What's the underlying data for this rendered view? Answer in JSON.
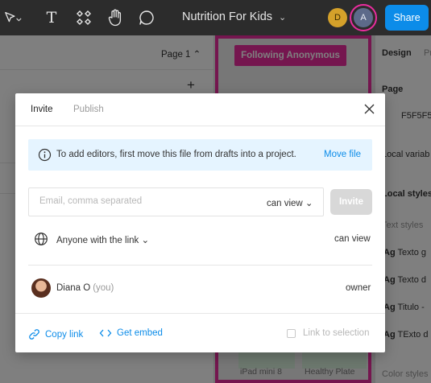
{
  "toolbar": {
    "title": "Nutrition For Kids",
    "title_chevron": "⌄",
    "text_tool": "T",
    "user_d": "D",
    "user_a": "A",
    "share": "Share"
  },
  "workspace": {
    "page_label": "Page 1 ⌃",
    "plus": "+",
    "follow_badge": "Following Anonymous",
    "thumb_labels": [
      "iPad mini 8",
      "Healthy Plate"
    ]
  },
  "right_panel": {
    "tabs": [
      "Design",
      "Pr"
    ],
    "page_heading": "Page",
    "page_color": "F5F5F5",
    "local_variables": "Local variab",
    "local_styles": "Local styles",
    "text_styles": "Text styles",
    "styles": [
      {
        "icon": "Ag",
        "name": "Texto g"
      },
      {
        "icon": "Ag",
        "name": "Texto d"
      },
      {
        "icon": "Ag",
        "name": "Titulo -"
      },
      {
        "icon": "Ag",
        "name": "TExto d"
      }
    ],
    "color_styles": "Color styles"
  },
  "modal": {
    "tabs": {
      "invite": "Invite",
      "publish": "Publish"
    },
    "notice": {
      "text": "To add editors, first move this file from drafts into a project.",
      "link": "Move file"
    },
    "email": {
      "placeholder": "Email, comma separated",
      "value": ""
    },
    "email_permission": "can view ⌄",
    "invite_button": "Invite",
    "link_access": "Anyone with the link ⌄",
    "link_permission": "can view",
    "member": {
      "name": "Diana O",
      "you": "(you)",
      "role": "owner"
    },
    "copy_link": "Copy link",
    "get_embed": "Get embed",
    "link_to_selection": "Link to selection"
  },
  "colors": {
    "accent_blue": "#0c8ce9",
    "follow_pink": "#ea2c9f",
    "toolbar_bg": "#2c2c2c",
    "notice_bg": "#e5f4ff"
  },
  "icons": [
    "move-tool-icon",
    "text-tool-icon",
    "components-icon",
    "hand-tool-icon",
    "comment-icon",
    "info-icon",
    "close-icon",
    "globe-icon",
    "link-icon",
    "code-icon"
  ]
}
